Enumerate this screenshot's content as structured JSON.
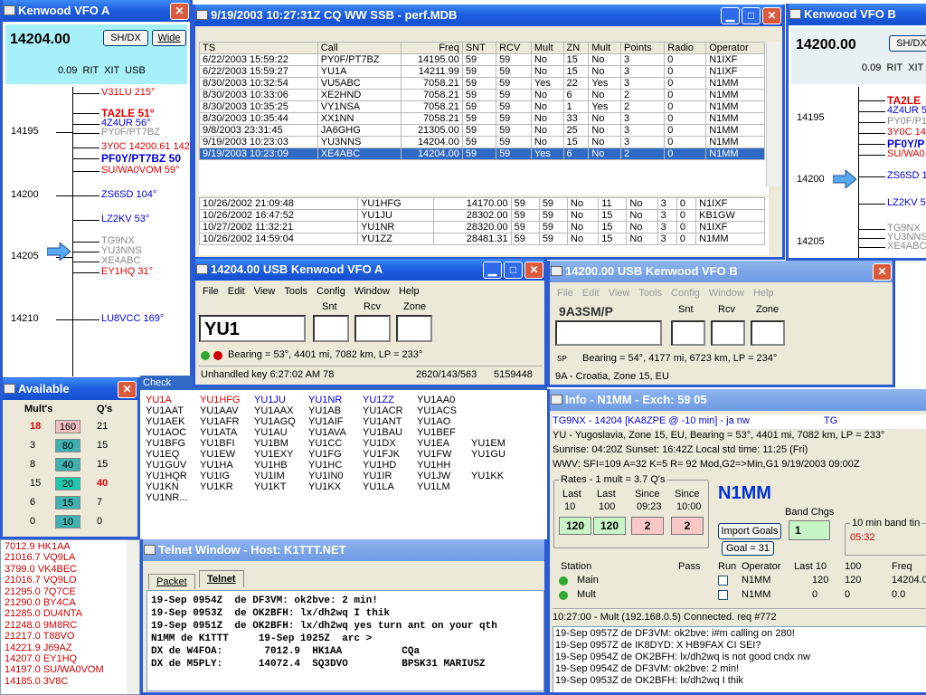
{
  "vfoA_band": {
    "title": "Kenwood VFO A",
    "freq": "14204.00",
    "sh_dx": "SH/DX",
    "wide": "Wide",
    "rit_line": "0.09  RIT  XIT  USB",
    "scale": [
      "14195",
      "14200",
      "14205",
      "14210"
    ],
    "spots": [
      {
        "t": "V31LU 215°",
        "c": "red"
      },
      {
        "t": "TA2LE 51°",
        "c": "redb"
      },
      {
        "t": "4Z4UR 56°",
        "c": "blue"
      },
      {
        "t": "PY0F/PT7BZ",
        "c": "gray"
      },
      {
        "t": "3Y0C 14200.61 142",
        "c": "red"
      },
      {
        "t": "PF0Y/PT7BZ 50",
        "c": "blueb"
      },
      {
        "t": "SU/WA0VOM 59°",
        "c": "red"
      },
      {
        "t": "ZS6SD 104°",
        "c": "blue"
      },
      {
        "t": "LZ2KV 53°",
        "c": "blue"
      },
      {
        "t": "TG9NX",
        "c": "gray"
      },
      {
        "t": "YU3NNS",
        "c": "gray"
      },
      {
        "t": "XE4ABC",
        "c": "gray"
      },
      {
        "t": "EY1HQ 31°",
        "c": "red"
      },
      {
        "t": "LU8VCC 169°",
        "c": "blue"
      }
    ]
  },
  "log": {
    "title": "9/19/2003 10:27:31Z  CQ WW SSB - perf.MDB",
    "headers": [
      "TS",
      "Call",
      "Freq",
      "SNT",
      "RCV",
      "Mult",
      "ZN",
      "Mult",
      "Points",
      "Radio",
      "Operator"
    ],
    "rows": [
      [
        "6/22/2003 15:59:22",
        "PY0F/PT7BZ",
        "14195.00",
        "59",
        "59",
        "No",
        "15",
        "No",
        "3",
        "0",
        "N1IXF"
      ],
      [
        "6/22/2003 15:59:27",
        "YU1A",
        "14211.99",
        "59",
        "59",
        "No",
        "15",
        "No",
        "3",
        "0",
        "N1IXF"
      ],
      [
        "8/30/2003 10:32:54",
        "VU5ABC",
        "7058.21",
        "59",
        "59",
        "Yes",
        "22",
        "Yes",
        "3",
        "0",
        "N1MM"
      ],
      [
        "8/30/2003 10:33:06",
        "XE2HND",
        "7058.21",
        "59",
        "59",
        "No",
        "6",
        "No",
        "2",
        "0",
        "N1MM"
      ],
      [
        "8/30/2003 10:35:25",
        "VY1NSA",
        "7058.21",
        "59",
        "59",
        "No",
        "1",
        "Yes",
        "2",
        "0",
        "N1MM"
      ],
      [
        "8/30/2003 10:35:44",
        "XX1NN",
        "7058.21",
        "59",
        "59",
        "No",
        "33",
        "No",
        "3",
        "0",
        "N1MM"
      ],
      [
        "9/8/2003 23:31:45",
        "JA6GHG",
        "21305.00",
        "59",
        "59",
        "No",
        "25",
        "No",
        "3",
        "0",
        "N1MM"
      ],
      [
        "9/19/2003 10:23:03",
        "YU3NNS",
        "14204.00",
        "59",
        "59",
        "No",
        "15",
        "No",
        "3",
        "0",
        "N1MM"
      ],
      [
        "9/19/2003 10:23:09",
        "XE4ABC",
        "14204.00",
        "59",
        "59",
        "Yes",
        "6",
        "No",
        "2",
        "0",
        "N1MM"
      ]
    ],
    "rows2": [
      [
        "10/26/2002 21:09:48",
        "YU1HFG",
        "14170.00",
        "59",
        "59",
        "No",
        "11",
        "No",
        "3",
        "0",
        "N1IXF"
      ],
      [
        "10/26/2002 16:47:52",
        "YU1JU",
        "28302.00",
        "59",
        "59",
        "No",
        "15",
        "No",
        "3",
        "0",
        "KB1GW"
      ],
      [
        "10/27/2002 11:32:21",
        "YU1NR",
        "28320.00",
        "59",
        "59",
        "No",
        "15",
        "No",
        "3",
        "0",
        "N1IXF"
      ],
      [
        "10/26/2002 14:59:04",
        "YU1ZZ",
        "28481.31",
        "59",
        "59",
        "No",
        "15",
        "No",
        "3",
        "0",
        "N1MM"
      ]
    ]
  },
  "vfoB_band": {
    "title": "Kenwood VFO B",
    "freq": "14200.00",
    "sh_dx": "SH/DX",
    "rit_line": "0.09  RIT  XIT",
    "scale": [
      "14195",
      "14200",
      "14205"
    ],
    "spots": [
      {
        "t": "TA2LE",
        "c": "redb"
      },
      {
        "t": "4Z4UR 5",
        "c": "blue"
      },
      {
        "t": "PY0F/P1",
        "c": "gray"
      },
      {
        "t": "3Y0C 14",
        "c": "red"
      },
      {
        "t": "PF0Y/P",
        "c": "blueb"
      },
      {
        "t": "SU/WA0",
        "c": "red"
      },
      {
        "t": "ZS6SD 1",
        "c": "blue"
      },
      {
        "t": "LZ2KV 5",
        "c": "blue"
      },
      {
        "t": "TG9NX",
        "c": "gray"
      },
      {
        "t": "YU3NNS",
        "c": "gray"
      },
      {
        "t": "XE4ABC",
        "c": "gray"
      }
    ]
  },
  "entryA": {
    "title": "14204.00 USB Kenwood VFO A",
    "menu": [
      "File",
      "Edit",
      "View",
      "Tools",
      "Config",
      "Window",
      "Help"
    ],
    "labels": {
      "snt": "Snt",
      "rcv": "Rcv",
      "zone": "Zone"
    },
    "call": "YU1",
    "bearing": "Bearing = 53°, 4401  mi, 7082 km, LP = 233°",
    "status1": "Unhandled key 6:27:02 AM 78",
    "status2": "2620/143/563",
    "status3": "5159448"
  },
  "entryB": {
    "title": "14200.00 USB Kenwood VFO B",
    "menu": [
      "File",
      "Edit",
      "View",
      "Tools",
      "Config",
      "Window",
      "Help"
    ],
    "call_label": "9A3SM/P",
    "labels": {
      "snt": "Snt",
      "rcv": "Rcv",
      "zone": "Zone"
    },
    "sp": "SP",
    "bearing": "Bearing = 54°, 4177  mi, 6723 km, LP = 234°",
    "status": "9A - Croatia, Zone 15, EU"
  },
  "available": {
    "title": "Available",
    "h1": "Mult's",
    "h2": "Q's",
    "rows": [
      {
        "m": "18",
        "b": "160",
        "q": "21",
        "mr": true,
        "bc": "#f0c0c0"
      },
      {
        "m": "3",
        "b": "80",
        "q": "15",
        "bc": "#40b0b0"
      },
      {
        "m": "8",
        "b": "40",
        "q": "15",
        "bc": "#40b0b0"
      },
      {
        "m": "15",
        "b": "20",
        "q": "40",
        "qr": true,
        "bc": "#20c8b0"
      },
      {
        "m": "6",
        "b": "15",
        "q": "7",
        "bc": "#40b0b0"
      },
      {
        "m": "0",
        "b": "10",
        "q": "0",
        "bc": "#40b0b0"
      }
    ]
  },
  "check": {
    "title": "Check",
    "rows": [
      [
        "YU1A",
        "YU1HFG",
        "YU1JU",
        "YU1NR",
        "YU1ZZ",
        "YU1AA0",
        ""
      ],
      [
        "YU1AAT",
        "YU1AAV",
        "YU1AAX",
        "YU1AB",
        "YU1ACR",
        "YU1ACS",
        ""
      ],
      [
        "YU1AEK",
        "YU1AFR",
        "YU1AGQ",
        "YU1AIF",
        "YU1ANT",
        "YU1AO",
        ""
      ],
      [
        "YU1AOC",
        "YU1ATA",
        "YU1AU",
        "YU1AVA",
        "YU1BAU",
        "YU1BEF",
        ""
      ],
      [
        "YU1BFG",
        "YU1BFI",
        "YU1BM",
        "YU1CC",
        "YU1DX",
        "YU1EA",
        "YU1EM"
      ],
      [
        "YU1EQ",
        "YU1EW",
        "YU1EXY",
        "YU1FG",
        "YU1FJK",
        "YU1FW",
        "YU1GU"
      ],
      [
        "YU1GUV",
        "YU1HA",
        "YU1HB",
        "YU1HC",
        "YU1HD",
        "YU1HH",
        ""
      ],
      [
        "YU1HQR",
        "YU1IG",
        "YU1IM",
        "YU1IN0",
        "YU1IR",
        "YU1JW",
        "YU1KK"
      ],
      [
        "YU1KN",
        "YU1KR",
        "YU1KT",
        "YU1KX",
        "YU1LA",
        "YU1LM",
        ""
      ],
      [
        "YU1NR...",
        "",
        "",
        "",
        "",
        "",
        ""
      ]
    ]
  },
  "spots_list": [
    "7012.9  HK1AA",
    "21016.7  VQ9LA",
    "3799.0  VK4BEC",
    "21016.7  VQ9LO",
    "21295.0  7Q7CE",
    "21290.0  BY4CA",
    "21285.0  DU4NTA",
    "21248.0  9M8RC",
    "21217.0  T88VO",
    "14221.9  J69AZ",
    "14207.0  EY1HQ",
    "14197.0  SU/WA0VOM",
    "14185.0  3V8C"
  ],
  "telnet": {
    "title": "Telnet Window - Host: K1TTT.NET",
    "tabs": [
      "Packet",
      "Telnet"
    ],
    "lines": [
      "19-Sep 0954Z  de DF3VM: ok2bve: 2 min!",
      "19-Sep 0953Z  de OK2BFH: lx/dh2wq I thik",
      "19-Sep 0951Z  de OK2BFH: lx/dh2wq yes turn ant on your qth",
      "N1MM de K1TTT     19-Sep 1025Z  arc >",
      "DX de W4FOA:       7012.9  HK1AA          CQa",
      "DX de M5PLY:      14072.4  SQ3DVO         BPSK31 MARIUSZ"
    ]
  },
  "info": {
    "title": "Info - N1MM - Exch: 59 05",
    "line1": "TG9NX - 14204 [KA8ZPE @ -10 min] - ja nw",
    "line1b": "TG",
    "line2": "YU - Yugoslavia, Zone 15, EU, Bearing = 53°, 4401  mi, 7082 km, LP = 233°",
    "line3": "Sunrise: 04:20Z   Sunset: 16:42Z  Local std time: 11:25 (Fri)",
    "line4": "WWV: SFI=109 A=32  K=5 R= 92 Mod,G2=>Min,G1 9/19/2003 09:00Z",
    "rates_label": "Rates - 1 mult = 3.7 Q's",
    "rate_heads": [
      "Last",
      "Last",
      "Since",
      "Since"
    ],
    "rate_heads2": [
      "10",
      "100",
      "09:23",
      "10:00"
    ],
    "rate_vals": [
      "120",
      "120",
      "2",
      "2"
    ],
    "operator": "N1MM",
    "band_chgs": "Band Chgs",
    "band_chgs_val": "1",
    "import_goals": "Import Goals",
    "goal": "Goal = 31",
    "ten_min": "10 min band tin",
    "ten_min_val": "05:32",
    "st_heads": [
      "Station",
      "Pass",
      "Run",
      "Operator",
      "Last 10",
      "100",
      "Freq"
    ],
    "stations": [
      {
        "n": "Main",
        "op": "N1MM",
        "l10": "120",
        "l100": "120",
        "f": "14204.0"
      },
      {
        "n": "Mult",
        "op": "N1MM",
        "l10": "0",
        "l100": "0",
        "f": "0.0"
      }
    ],
    "conn": "10:27:00 - Mult (192.168.0.5) Connected.  req #772",
    "log": [
      "19-Sep 0957Z  de DF3VM: ok2bve: i#m calling on 280!",
      "19-Sep 0957Z  de IK8DYD: X HB9FAX CI SEI?",
      "19-Sep 0954Z  de OK2BFH: lx/dh2wq  is not good cndx nw",
      "19-Sep 0954Z  de DF3VM: ok2bve: 2 min!",
      "19-Sep 0953Z  de OK2BFH: lx/dh2wq I thik"
    ]
  }
}
